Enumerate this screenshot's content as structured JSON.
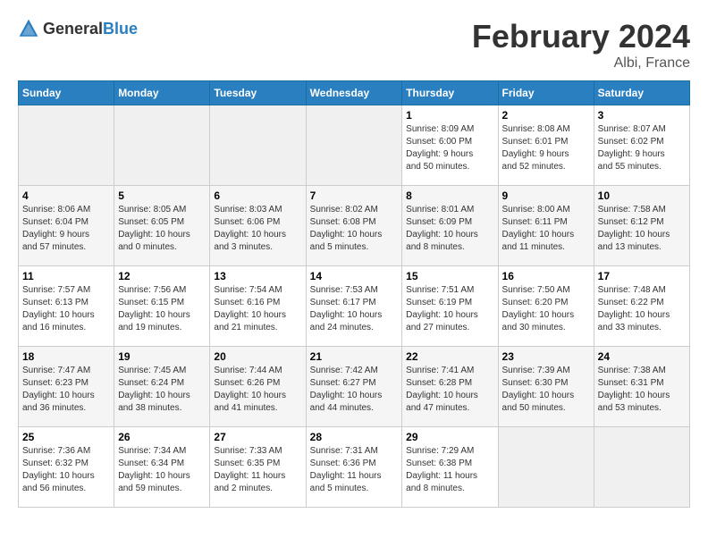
{
  "header": {
    "logo_general": "General",
    "logo_blue": "Blue",
    "month_title": "February 2024",
    "location": "Albi, France"
  },
  "calendar": {
    "days_of_week": [
      "Sunday",
      "Monday",
      "Tuesday",
      "Wednesday",
      "Thursday",
      "Friday",
      "Saturday"
    ],
    "weeks": [
      [
        {
          "day": "",
          "info": ""
        },
        {
          "day": "",
          "info": ""
        },
        {
          "day": "",
          "info": ""
        },
        {
          "day": "",
          "info": ""
        },
        {
          "day": "1",
          "info": "Sunrise: 8:09 AM\nSunset: 6:00 PM\nDaylight: 9 hours\nand 50 minutes."
        },
        {
          "day": "2",
          "info": "Sunrise: 8:08 AM\nSunset: 6:01 PM\nDaylight: 9 hours\nand 52 minutes."
        },
        {
          "day": "3",
          "info": "Sunrise: 8:07 AM\nSunset: 6:02 PM\nDaylight: 9 hours\nand 55 minutes."
        }
      ],
      [
        {
          "day": "4",
          "info": "Sunrise: 8:06 AM\nSunset: 6:04 PM\nDaylight: 9 hours\nand 57 minutes."
        },
        {
          "day": "5",
          "info": "Sunrise: 8:05 AM\nSunset: 6:05 PM\nDaylight: 10 hours\nand 0 minutes."
        },
        {
          "day": "6",
          "info": "Sunrise: 8:03 AM\nSunset: 6:06 PM\nDaylight: 10 hours\nand 3 minutes."
        },
        {
          "day": "7",
          "info": "Sunrise: 8:02 AM\nSunset: 6:08 PM\nDaylight: 10 hours\nand 5 minutes."
        },
        {
          "day": "8",
          "info": "Sunrise: 8:01 AM\nSunset: 6:09 PM\nDaylight: 10 hours\nand 8 minutes."
        },
        {
          "day": "9",
          "info": "Sunrise: 8:00 AM\nSunset: 6:11 PM\nDaylight: 10 hours\nand 11 minutes."
        },
        {
          "day": "10",
          "info": "Sunrise: 7:58 AM\nSunset: 6:12 PM\nDaylight: 10 hours\nand 13 minutes."
        }
      ],
      [
        {
          "day": "11",
          "info": "Sunrise: 7:57 AM\nSunset: 6:13 PM\nDaylight: 10 hours\nand 16 minutes."
        },
        {
          "day": "12",
          "info": "Sunrise: 7:56 AM\nSunset: 6:15 PM\nDaylight: 10 hours\nand 19 minutes."
        },
        {
          "day": "13",
          "info": "Sunrise: 7:54 AM\nSunset: 6:16 PM\nDaylight: 10 hours\nand 21 minutes."
        },
        {
          "day": "14",
          "info": "Sunrise: 7:53 AM\nSunset: 6:17 PM\nDaylight: 10 hours\nand 24 minutes."
        },
        {
          "day": "15",
          "info": "Sunrise: 7:51 AM\nSunset: 6:19 PM\nDaylight: 10 hours\nand 27 minutes."
        },
        {
          "day": "16",
          "info": "Sunrise: 7:50 AM\nSunset: 6:20 PM\nDaylight: 10 hours\nand 30 minutes."
        },
        {
          "day": "17",
          "info": "Sunrise: 7:48 AM\nSunset: 6:22 PM\nDaylight: 10 hours\nand 33 minutes."
        }
      ],
      [
        {
          "day": "18",
          "info": "Sunrise: 7:47 AM\nSunset: 6:23 PM\nDaylight: 10 hours\nand 36 minutes."
        },
        {
          "day": "19",
          "info": "Sunrise: 7:45 AM\nSunset: 6:24 PM\nDaylight: 10 hours\nand 38 minutes."
        },
        {
          "day": "20",
          "info": "Sunrise: 7:44 AM\nSunset: 6:26 PM\nDaylight: 10 hours\nand 41 minutes."
        },
        {
          "day": "21",
          "info": "Sunrise: 7:42 AM\nSunset: 6:27 PM\nDaylight: 10 hours\nand 44 minutes."
        },
        {
          "day": "22",
          "info": "Sunrise: 7:41 AM\nSunset: 6:28 PM\nDaylight: 10 hours\nand 47 minutes."
        },
        {
          "day": "23",
          "info": "Sunrise: 7:39 AM\nSunset: 6:30 PM\nDaylight: 10 hours\nand 50 minutes."
        },
        {
          "day": "24",
          "info": "Sunrise: 7:38 AM\nSunset: 6:31 PM\nDaylight: 10 hours\nand 53 minutes."
        }
      ],
      [
        {
          "day": "25",
          "info": "Sunrise: 7:36 AM\nSunset: 6:32 PM\nDaylight: 10 hours\nand 56 minutes."
        },
        {
          "day": "26",
          "info": "Sunrise: 7:34 AM\nSunset: 6:34 PM\nDaylight: 10 hours\nand 59 minutes."
        },
        {
          "day": "27",
          "info": "Sunrise: 7:33 AM\nSunset: 6:35 PM\nDaylight: 11 hours\nand 2 minutes."
        },
        {
          "day": "28",
          "info": "Sunrise: 7:31 AM\nSunset: 6:36 PM\nDaylight: 11 hours\nand 5 minutes."
        },
        {
          "day": "29",
          "info": "Sunrise: 7:29 AM\nSunset: 6:38 PM\nDaylight: 11 hours\nand 8 minutes."
        },
        {
          "day": "",
          "info": ""
        },
        {
          "day": "",
          "info": ""
        }
      ]
    ]
  }
}
